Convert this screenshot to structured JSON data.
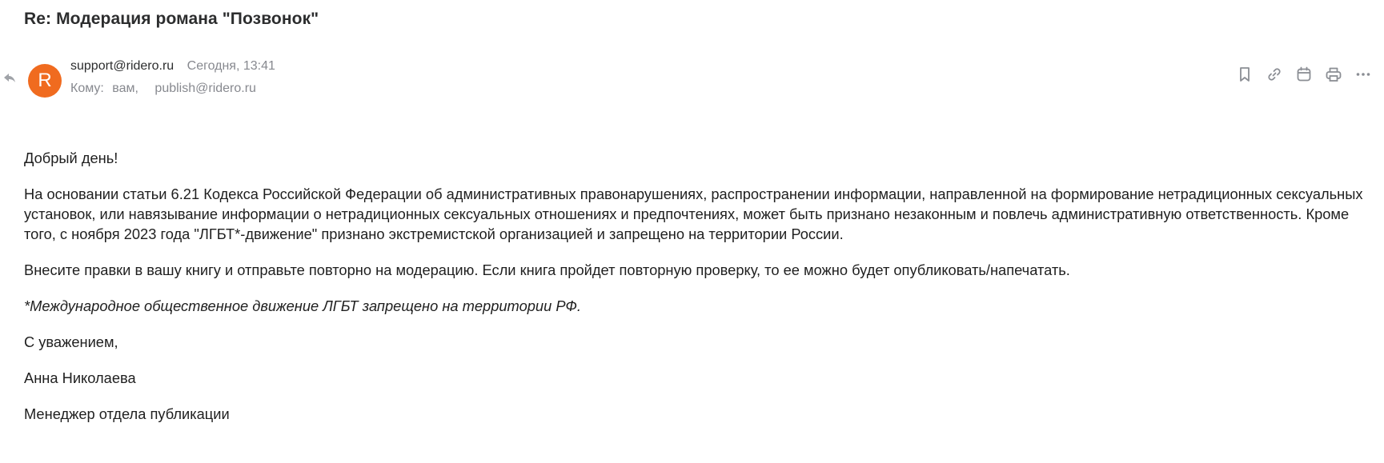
{
  "subject": "Re: Модерация романа \"Позвонок\"",
  "sender": {
    "avatar_letter": "R",
    "avatar_color": "#f06b1f",
    "email": "support@ridero.ru",
    "date": "Сегодня, 13:41"
  },
  "recipients": {
    "label": "Кому:",
    "list": [
      "вам,",
      "publish@ridero.ru"
    ]
  },
  "toolbar": {
    "icons": [
      "bookmark-icon",
      "link-icon",
      "calendar-icon",
      "print-icon",
      "more-icon"
    ]
  },
  "body": {
    "greeting": "Добрый день!",
    "paragraph1": "На основании статьи 6.21 Кодекса Российской Федерации об административных правонарушениях, распространении информации, направленной на формирование нетрадиционных сексуальных установок, или навязывание информации о нетрадиционных сексуальных отношениях и предпочтениях, может быть признано незаконным и повлечь административную ответственность. Кроме того, с ноября 2023 года \"ЛГБТ*-движение\" признано экстремистской организацией и запрещено на территории России.",
    "paragraph2": "Внесите правки в вашу книгу и отправьте повторно на модерацию. Если книга пройдет повторную проверку, то ее можно будет опубликовать/напечатать.",
    "footnote": "*Международное общественное движение ЛГБТ запрещено на территории РФ.",
    "closing": "С уважением,",
    "name": "Анна Николаева",
    "position": "Менеджер отдела публикации"
  }
}
